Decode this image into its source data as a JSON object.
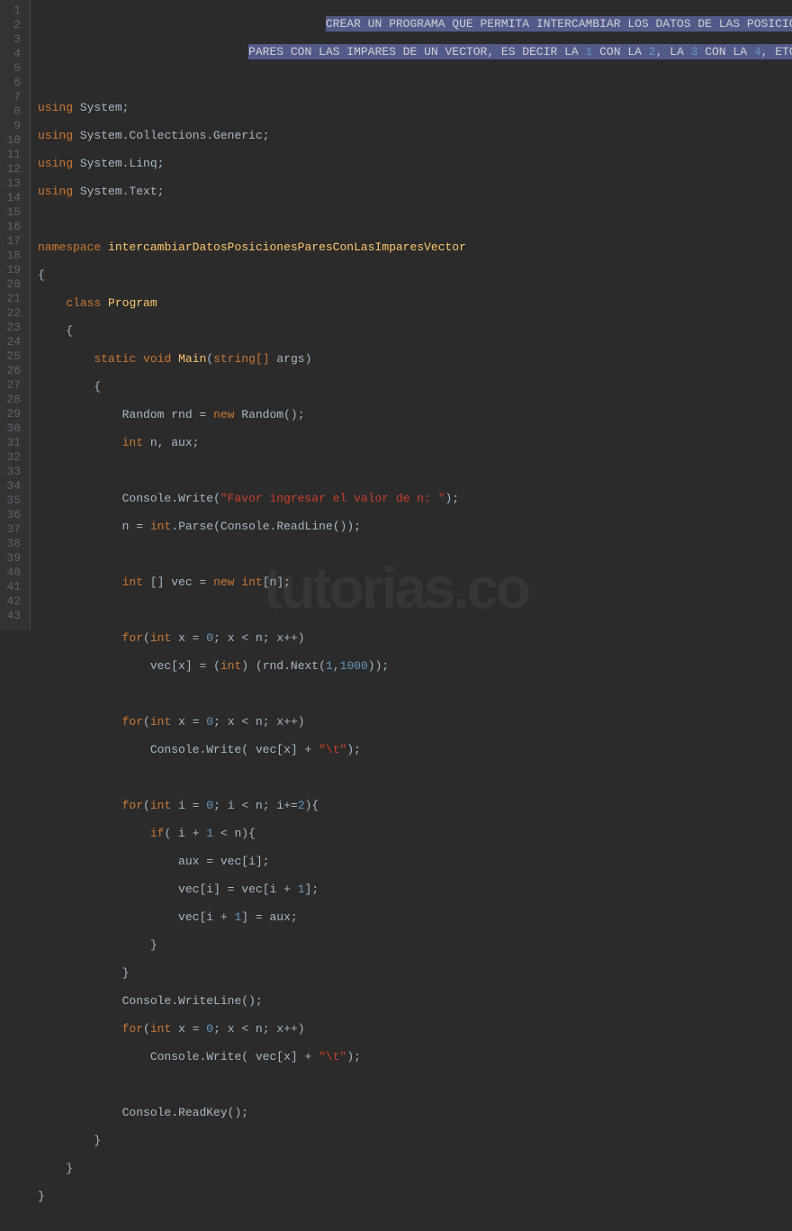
{
  "watermark": "tutorias.co",
  "line_count": 43,
  "comment": {
    "line1": "CREAR UN PROGRAMA QUE PERMITA INTERCAMBIAR LOS DATOS DE LAS POSICIONES",
    "line2_a": "PARES CON LAS IMPARES DE UN VECTOR, ES DECIR LA ",
    "line2_b": " CON LA ",
    "line2_c": ", LA ",
    "line2_d": " CON LA ",
    "line2_e": ", ETC ...",
    "n1": "1",
    "n2": "2",
    "n3": "3",
    "n4": "4"
  },
  "code": {
    "using": "using",
    "namespace_kw": "namespace",
    "class_kw": "class",
    "static_kw": "static",
    "void_kw": "void",
    "new_kw": "new",
    "int_kw": "int",
    "for_kw": "for",
    "if_kw": "if",
    "system": "System",
    "collections_generic": "System.Collections.Generic",
    "linq": "System.Linq",
    "text": "System.Text",
    "namespace_name": "intercambiarDatosPosicionesParesConLasImparesVector",
    "program": "Program",
    "main": "Main",
    "string_arr": "string[]",
    "args": "args",
    "random": "Random",
    "rnd": "rnd",
    "n_aux": "n, aux",
    "console": "Console",
    "write": "Write",
    "writeline": "WriteLine",
    "readline": "ReadLine",
    "readkey": "ReadKey",
    "parse": "Parse",
    "next": "Next",
    "str_prompt": "\"Favor ingresar el valor de n: \"",
    "str_tab": "\"\\t\"",
    "vec": "vec",
    "n_var": "n",
    "aux_var": "aux",
    "x_var": "x",
    "i_var": "i",
    "zero": "0",
    "one": "1",
    "two": "2",
    "thousand": "1000"
  }
}
